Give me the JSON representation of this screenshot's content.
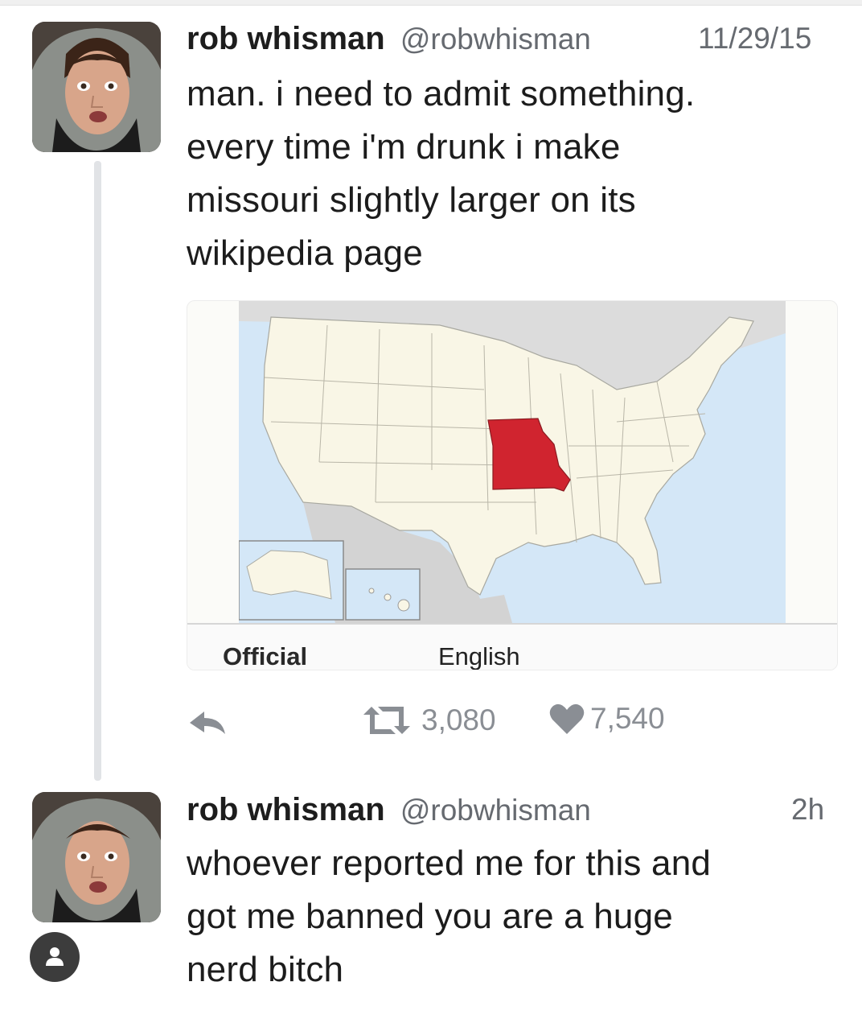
{
  "tweets": [
    {
      "name": "rob whisman",
      "handle": "@robwhisman",
      "time": "11/29/15",
      "text_lines": [
        "man. i need to admit something.",
        "every time i'm drunk i make",
        "missouri slightly larger on its",
        "wikipedia page"
      ],
      "media": {
        "caption_left": "Official",
        "caption_right": "English",
        "highlight_color": "#d0242f",
        "land_color": "#f9f6e6",
        "water_color": "#d4e7f7"
      },
      "actions": {
        "reply_icon": "reply-icon",
        "retweet_icon": "retweet-icon",
        "retweets": "3,080",
        "like_icon": "heart-icon",
        "likes": "7,540"
      }
    },
    {
      "name": "rob whisman",
      "handle": "@robwhisman",
      "time": "2h",
      "text_lines": [
        "whoever reported me for this and",
        "got me banned you are a huge",
        "nerd bitch"
      ],
      "badge_icon": "lock-icon"
    }
  ]
}
